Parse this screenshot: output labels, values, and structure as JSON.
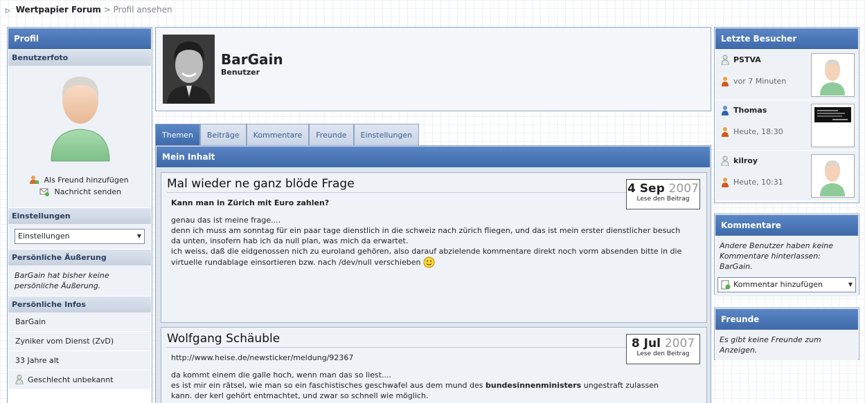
{
  "breadcrumb": {
    "home": "Wertpapier Forum",
    "separator": ">",
    "current": "Profil ansehen"
  },
  "left": {
    "title": "Profil",
    "photo_header": "Benutzerfoto",
    "add_friend": "Als Freund hinzufügen",
    "send_message": "Nachricht senden",
    "settings_header": "Einstellungen",
    "settings_select": "Einstellungen",
    "statement_header": "Persönliche Äußerung",
    "statement_text": "BarGain hat bisher keine persönliche Äußerung.",
    "info_header": "Persönliche Infos",
    "info": [
      "BarGain",
      "Zyniker vom Dienst (ZvD)",
      "33 Jahre alt",
      "Geschlecht unbekannt"
    ]
  },
  "profile": {
    "name": "BarGain",
    "role": "Benutzer"
  },
  "tabs": [
    "Themen",
    "Beiträge",
    "Kommentare",
    "Freunde",
    "Einstellungen"
  ],
  "content": {
    "header": "Mein Inhalt",
    "entries": [
      {
        "title": "Mal wieder ne ganz blöde Frage",
        "date_dm": "4 Sep",
        "date_y": "2007",
        "read": "Lese den Beitrag",
        "lead": "Kann man in Zürich mit Euro zahlen?",
        "p1": "genau das ist meine frage....",
        "p2": "denn ich muss am sonntag für ein paar tage dienstlich in die schweiz nach zürich fliegen, und das ist mein erster dienstlicher besuch da unten, insofern hab ich da null plan, was mich da erwartet.",
        "p3": "ich weiss, daß die eidgenossen nich zu euroland gehören, also darauf abzielende kommentare direkt noch vorm absenden bitte in die virtuelle rundablage einsortieren bzw. nach /dev/null verschieben"
      },
      {
        "title": "Wolfgang Schäuble",
        "date_dm": "8 Jul",
        "date_y": "2007",
        "read": "Lese den Beitrag",
        "lead": "http://www.heise.de/newsticker/meldung/92367",
        "p1": "da kommt einem die galle hoch, wenn man das so liest....",
        "p2a": "es ist mir ein rätsel, wie man so ein faschistisches geschwafel aus dem mund des",
        "p2b": "bundesinnenministers",
        "p2c": "ungestraft zulassen",
        "p3": "kann. der kerl gehört entmachtet, und zwar so schnell wie möglich."
      }
    ]
  },
  "visitors": {
    "title": "Letzte Besucher",
    "items": [
      {
        "name": "PSTVA",
        "time": "vor 7 Minuten"
      },
      {
        "name": "Thomas",
        "time": "Heute, 18:30"
      },
      {
        "name": "kilroy",
        "time": "Heute, 10:31"
      }
    ]
  },
  "comments": {
    "title": "Kommentare",
    "text": "Andere Benutzer haben keine Kommentare hinterlassen: BarGain.",
    "add": "Kommentar hinzufügen"
  },
  "friends": {
    "title": "Freunde",
    "text": "Es gibt keine Freunde zum Anzeigen."
  }
}
